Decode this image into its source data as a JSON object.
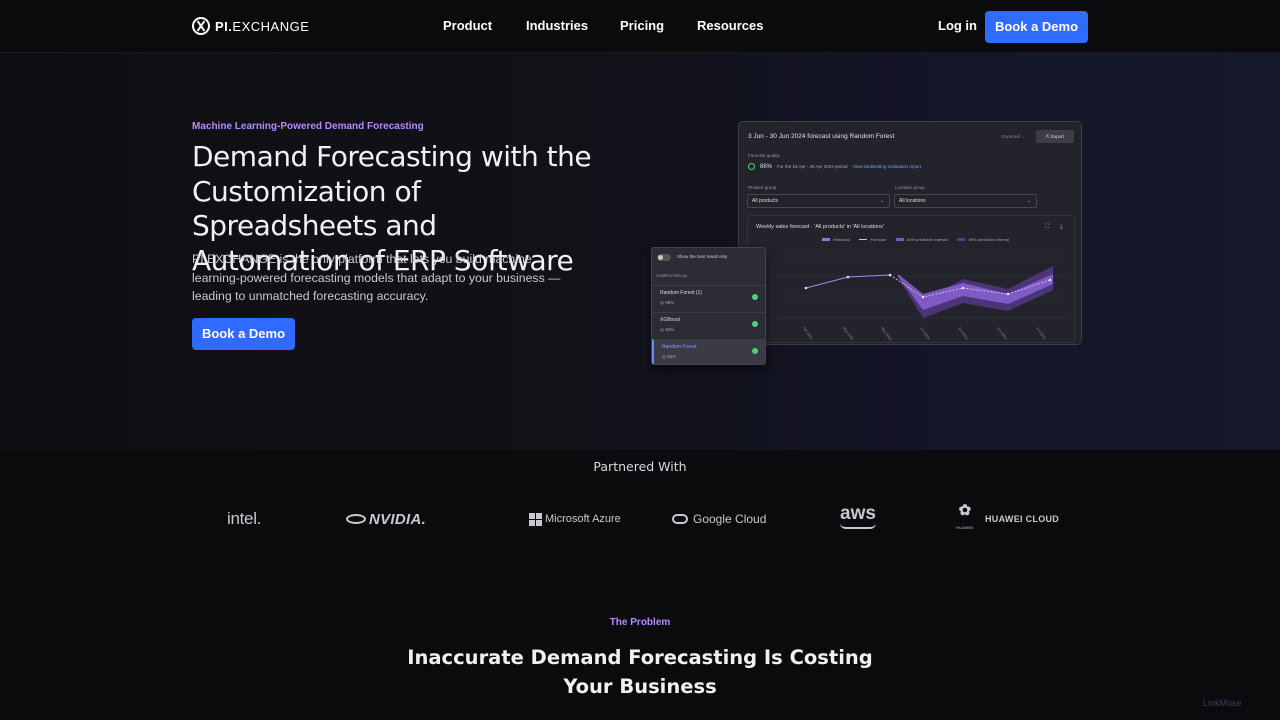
{
  "nav": {
    "logo_bold": "PI.",
    "logo_rest": "EXCHANGE",
    "items": [
      "Product",
      "Industries",
      "Pricing",
      "Resources"
    ],
    "login": "Log in",
    "cta": "Book a Demo"
  },
  "hero": {
    "eyebrow": "Machine Learning-Powered Demand Forecasting",
    "title": "Demand Forecasting with the Customization of Spreadsheets and Automation of ERP Software",
    "subtitle": "PI.EXCHANGE is the only platform that lets you build machine learning-powered forecasting models that adapt to your business — leading to unmatched forecasting accuracy.",
    "cta": "Book a Demo"
  },
  "card": {
    "title": "3 Jun - 30 Jun 2024 forecast using Random Forest",
    "expand": "Exported ⌄",
    "export": "Export",
    "quality_label": "Forecast quality",
    "accuracy": "86%",
    "period": "For the 15 Apr - 28 Apr 2024 period",
    "link": "View backtesting evaluation report",
    "product_label": "Product group",
    "product_value": "All products",
    "location_label": "Location group",
    "location_value": "All locations",
    "chart_title": "Weekly sales forecast  ·  'All products' in 'All locations'",
    "legend": [
      "Historical",
      "Forecast",
      "80% prediction interval",
      "95% prediction interval"
    ]
  },
  "panel": {
    "show_best": "Show the best result only",
    "completed": "COMPLETED (3)",
    "models": [
      {
        "name": "Random Forest (1)",
        "acc": "89%"
      },
      {
        "name": "XGBoost",
        "acc": "93%"
      },
      {
        "name": "Random Forest",
        "acc": "86%"
      }
    ]
  },
  "partners": {
    "label": "Partnered With",
    "logos": [
      "intel.",
      "NVIDIA.",
      "Microsoft Azure",
      "Google Cloud",
      "aws",
      "HUAWEI CLOUD"
    ],
    "huawei_sub": "HUAWEI"
  },
  "problem": {
    "eyebrow": "The Problem",
    "title": "Inaccurate Demand Forecasting Is Costing Your Business"
  },
  "badge": "LinkMuse",
  "colors": {
    "accent": "#2f6bff",
    "eyebrow": "#b48cff",
    "forecast": "#7e55c9"
  }
}
